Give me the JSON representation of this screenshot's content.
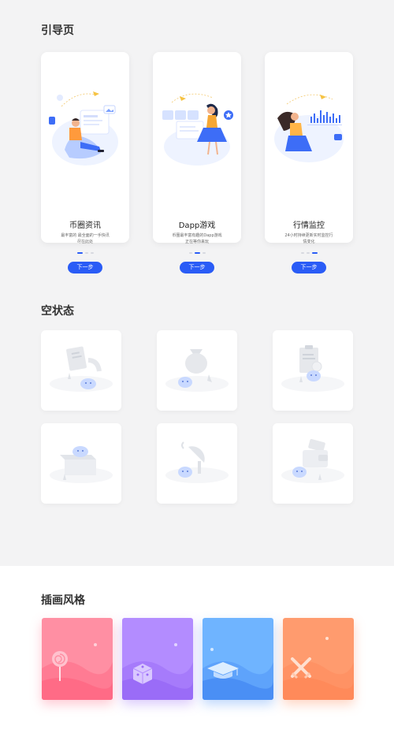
{
  "sections": {
    "onboarding_title": "引导页",
    "empty_title": "空状态",
    "illustration_title": "插画风格"
  },
  "onboarding": [
    {
      "title": "币圈资讯",
      "desc_line1": "最丰富的 最全面的一手快讯",
      "desc_line2": "尽在此处",
      "button": "下一步",
      "active_dot": 0
    },
    {
      "title": "Dapp游戏",
      "desc_line1": "币圈最丰富有趣的Dapp游戏",
      "desc_line2": "正在等你来玩",
      "button": "下一步",
      "active_dot": 1
    },
    {
      "title": "行情监控",
      "desc_line1": "24小时持续更新实时监控行",
      "desc_line2": "情变化",
      "button": "下一步",
      "active_dot": 2
    }
  ],
  "empty_states": [
    {
      "icon": "document-icon"
    },
    {
      "icon": "money-bag-icon"
    },
    {
      "icon": "clipboard-icon"
    },
    {
      "icon": "open-box-icon"
    },
    {
      "icon": "satellite-dish-icon"
    },
    {
      "icon": "wallet-icon"
    }
  ],
  "illustration_styles": [
    {
      "icon": "lollipop-icon",
      "color_top": "#ff8fa3",
      "color_bottom": "#ff6b86"
    },
    {
      "icon": "dice-icon",
      "color_top": "#b38cff",
      "color_bottom": "#9a6cf7"
    },
    {
      "icon": "graduation-cap-icon",
      "color_top": "#6fb4ff",
      "color_bottom": "#4a8ff5"
    },
    {
      "icon": "crossed-swords-icon",
      "color_top": "#ff9b6e",
      "color_bottom": "#ff8a5a"
    }
  ],
  "colors": {
    "primary": "#2a5cf6",
    "background": "#f3f3f4"
  }
}
